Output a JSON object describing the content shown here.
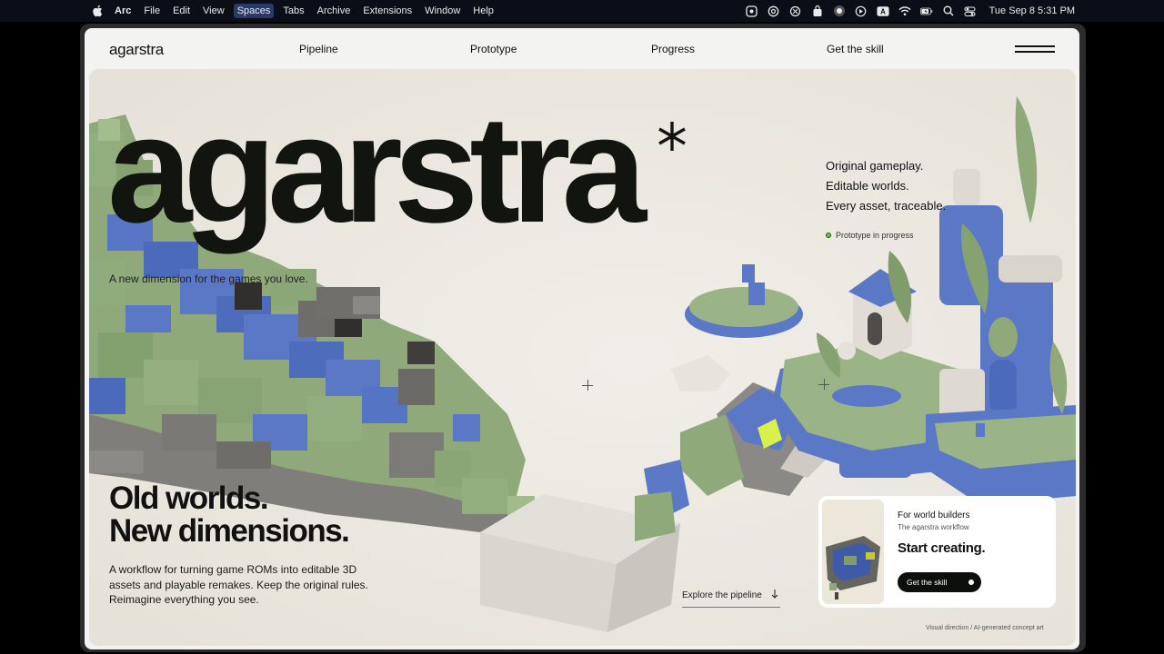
{
  "menubar": {
    "apple_icon": "apple-logo-icon",
    "app_name": "Arc",
    "items": [
      "File",
      "Edit",
      "View",
      "Spaces",
      "Tabs",
      "Archive",
      "Extensions",
      "Window",
      "Help"
    ],
    "status_icons": [
      "app-icon",
      "threads-icon",
      "openai-icon",
      "bag-icon",
      "screen-record-icon",
      "play-icon",
      "keyboard-input-icon",
      "wifi-icon",
      "battery-icon",
      "search-icon",
      "control-center-icon"
    ],
    "input_letter": "A",
    "clock": "Tue Sep 8  5:31 PM"
  },
  "nav": {
    "logo": "agarstra",
    "links": [
      "Pipeline",
      "Prototype",
      "Progress",
      "Get the skill"
    ],
    "menu_icon": "hamburger-menu-icon"
  },
  "hero": {
    "title": "agarstra",
    "tagline": "A new dimension for the games you love.",
    "features": [
      "Original gameplay.",
      "Editable worlds.",
      "Every asset, traceable."
    ],
    "status": "Prototype in progress",
    "headline_line1": "Old worlds.",
    "headline_line2": "New dimensions.",
    "description": "A workflow for turning game ROMs into editable 3D assets and playable remakes. Keep the original rules. Reimagine everything you see.",
    "explore_label": "Explore the pipeline",
    "explore_icon": "arrow-down-icon",
    "credit": "Visual direction / AI-generated concept art"
  },
  "cta": {
    "kicker": "For world builders",
    "subtitle": "The agarstra workflow",
    "title": "Start creating.",
    "button_label": "Get the skill"
  },
  "colors": {
    "background": "#ece9e2",
    "text": "#111111",
    "green_block": "#8fae7a",
    "blue_block": "#5a78c6",
    "gray_block": "#6b6a67",
    "status_dot": "#6fc23a"
  }
}
